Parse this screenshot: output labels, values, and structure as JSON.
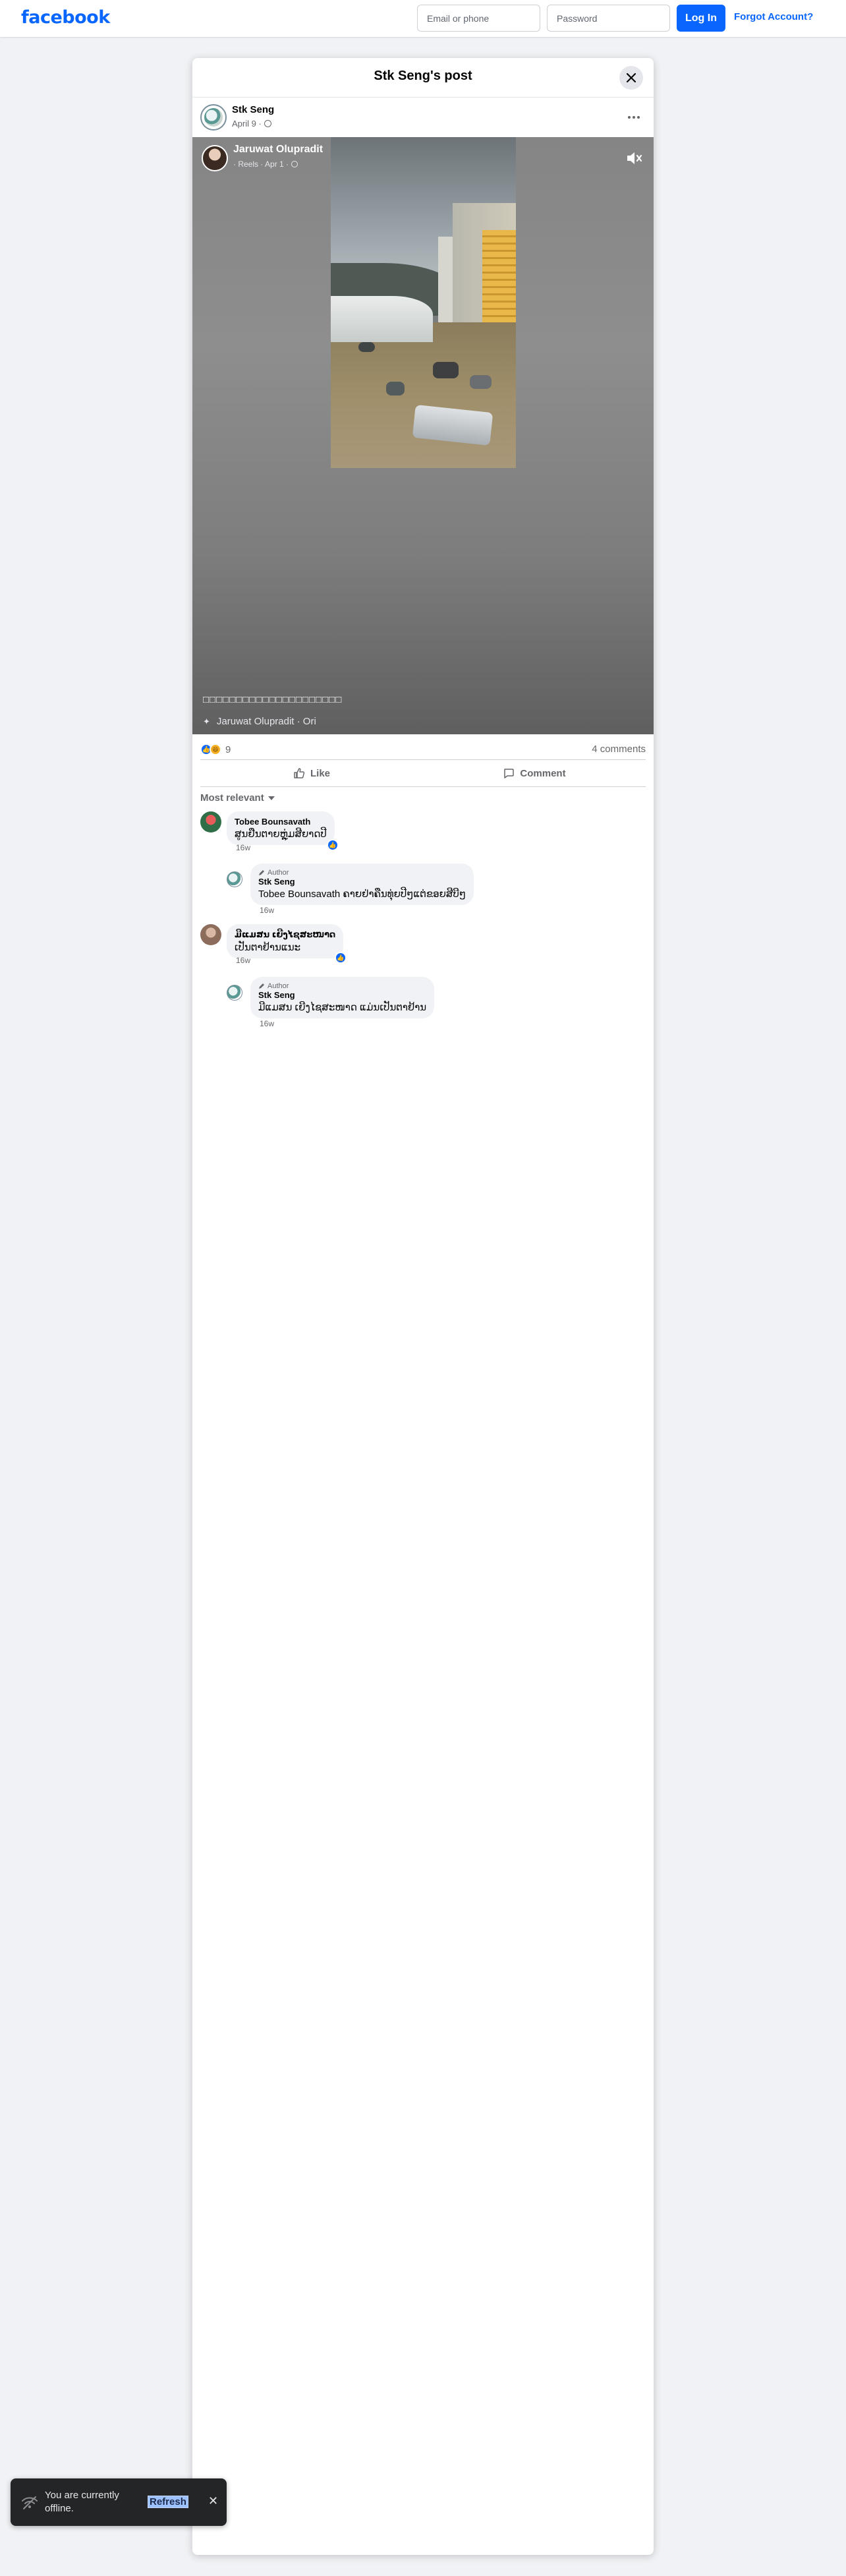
{
  "topbar": {
    "logo": "facebook",
    "email_placeholder": "Email or phone",
    "password_placeholder": "Password",
    "login_label": "Log In",
    "forgot_label": "Forgot Account?"
  },
  "dialog": {
    "title": "Stk Seng's post",
    "close_icon": "close-icon"
  },
  "post": {
    "author": "Stk Seng",
    "date": "April 9 ·",
    "privacy_icon": "globe-icon"
  },
  "video": {
    "owner": "Jaruwat Olupradit",
    "sub": "· Reels · Apr 1 ·",
    "caption": "□□□□□□□□□□□□□□□□□□□□□",
    "audio": "Jaruwat Olupradit · Ori",
    "mute_icon": "speaker-muted-icon"
  },
  "stats": {
    "reaction_count": "9",
    "comments_label": "4 comments"
  },
  "actions": {
    "like": "Like",
    "comment": "Comment"
  },
  "sort_label": "Most relevant",
  "comments": [
    {
      "name": "Tobee Bounsavath",
      "text": "ສູນຢືນຕາຍຫຼຸ່ມສີຍາດປີ",
      "time": "16w"
    },
    {
      "badge": "Author",
      "name": "Stk Seng",
      "text": "Tobee Bounsavath ຄາຍຢ່າຄືນທຸ່ຍປີໆແຕ່ຂອຍສີບີໆ",
      "time": "16w"
    },
    {
      "name": "ມີແມສນ ເຍີງໄຊສະໜາດ",
      "text": "ເປັນຕາຢ້ານແນະ",
      "time": "16w"
    },
    {
      "badge": "Author",
      "name": "Stk Seng",
      "text": "ມີແມສນ ເຍີງໄຊສະໜາດ ແມ່ນເປັນຕາຢ້ານ",
      "time": "16w"
    }
  ],
  "toast": {
    "text": "You are currently offline.",
    "refresh": "Refresh"
  },
  "colors": {
    "brand": "#0866ff",
    "background": "#f0f2f5",
    "toast_bg": "#242526"
  }
}
